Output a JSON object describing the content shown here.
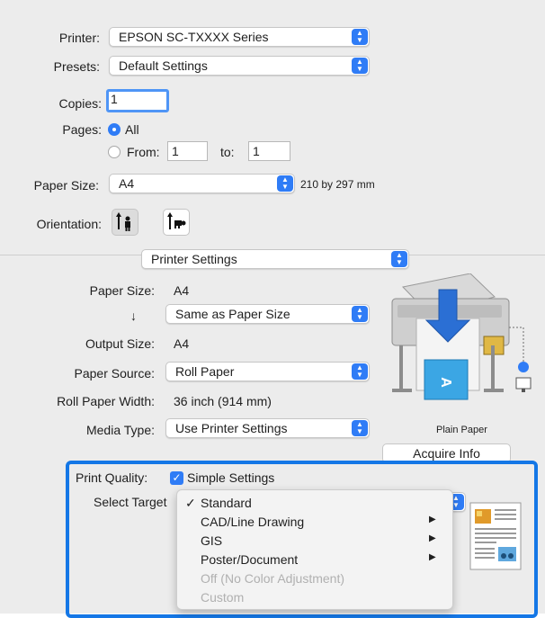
{
  "header": {
    "printer_label": "Printer:",
    "printer_value": "EPSON SC-TXXXX Series",
    "presets_label": "Presets:",
    "presets_value": "Default Settings",
    "copies_label": "Copies:",
    "copies_value": "1",
    "pages_label": "Pages:",
    "pages_all": "All",
    "pages_from": "From:",
    "pages_from_value": "1",
    "pages_to": "to:",
    "pages_to_value": "1",
    "paper_size_label": "Paper Size:",
    "paper_size_value": "A4",
    "paper_size_dims": "210 by 297 mm",
    "orientation_label": "Orientation:",
    "orientation_selected": "portrait"
  },
  "panel_selector": {
    "value": "Printer Settings"
  },
  "settings": {
    "paper_size_label": "Paper Size:",
    "paper_size_value": "A4",
    "down_arrow": "↓",
    "scale_value": "Same as Paper Size",
    "output_size_label": "Output Size:",
    "output_size_value": "A4",
    "paper_source_label": "Paper Source:",
    "paper_source_value": "Roll Paper",
    "roll_width_label": "Roll Paper Width:",
    "roll_width_value": "36 inch (914 mm)",
    "media_type_label": "Media Type:",
    "media_type_value": "Use Printer Settings",
    "preview_caption": "Plain Paper",
    "acquire_button": "Acquire Info"
  },
  "quality": {
    "label": "Print Quality:",
    "simple_settings_label": "Simple Settings",
    "simple_settings_checked": true,
    "select_target_label": "Select Target"
  },
  "target_menu": {
    "items": [
      {
        "label": "Standard",
        "checked": true,
        "submenu": false,
        "enabled": true
      },
      {
        "label": "CAD/Line Drawing",
        "checked": false,
        "submenu": true,
        "enabled": true
      },
      {
        "label": "GIS",
        "checked": false,
        "submenu": true,
        "enabled": true
      },
      {
        "label": "Poster/Document",
        "checked": false,
        "submenu": true,
        "enabled": true
      },
      {
        "label": "Off (No Color Adjustment)",
        "checked": false,
        "submenu": false,
        "enabled": false
      },
      {
        "label": "Custom",
        "checked": false,
        "submenu": false,
        "enabled": false
      }
    ]
  },
  "colors": {
    "accent": "#2f7cf6",
    "highlight_border": "#1477e6"
  }
}
